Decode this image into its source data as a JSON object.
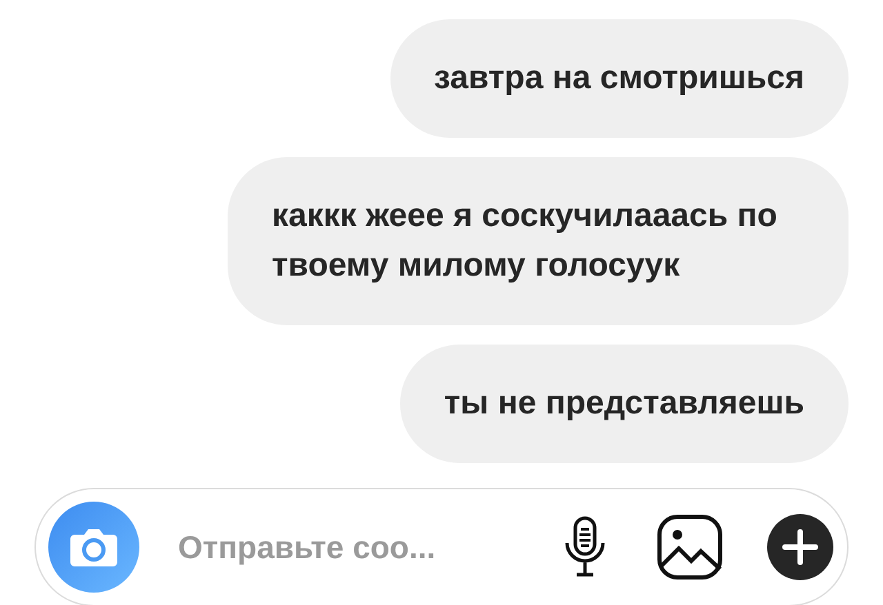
{
  "messages": [
    {
      "text": "завтра на смотришься"
    },
    {
      "text": "каккк жеее я соскучилааась по твоему милому голосуук"
    },
    {
      "text": "ты не представляешь"
    }
  ],
  "composer": {
    "placeholder": "Отправьте соо..."
  }
}
